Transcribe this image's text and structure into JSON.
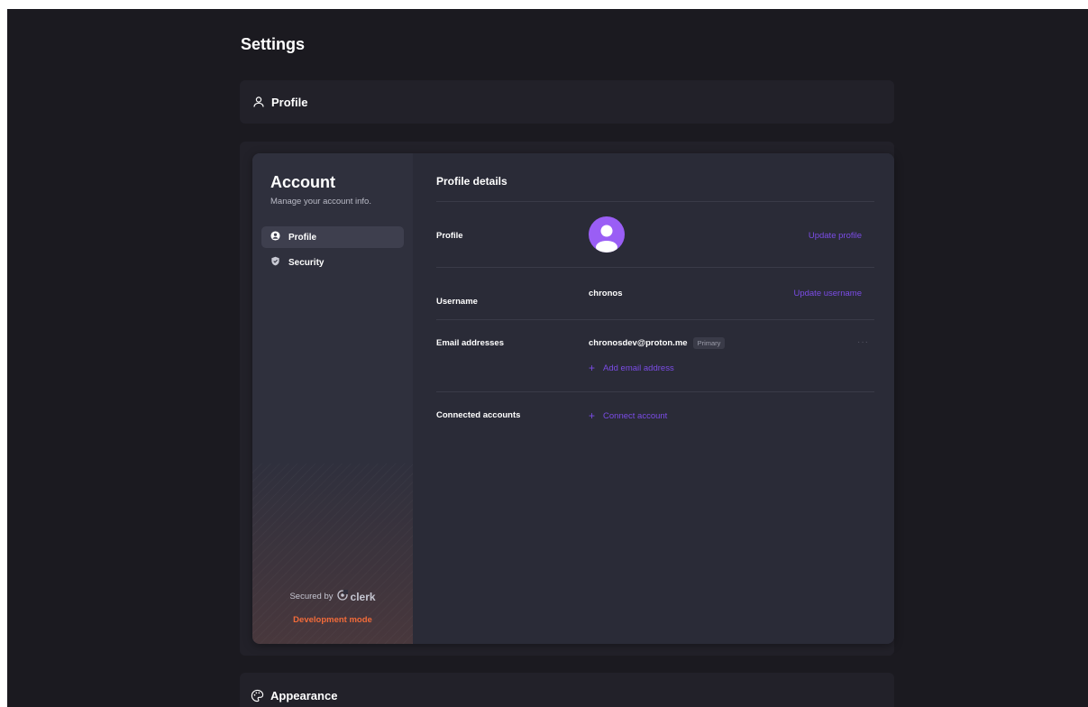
{
  "page": {
    "title": "Settings"
  },
  "sections": {
    "profile": {
      "label": "Profile"
    },
    "appearance": {
      "label": "Appearance"
    }
  },
  "account": {
    "title": "Account",
    "subtitle": "Manage your account info.",
    "nav": [
      {
        "label": "Profile",
        "icon": "user-circle-icon",
        "active": true
      },
      {
        "label": "Security",
        "icon": "shield-icon",
        "active": false
      }
    ],
    "footer": {
      "secured_by": "Secured by",
      "brand": "clerk",
      "mode": "Development mode"
    }
  },
  "profile_details": {
    "title": "Profile details",
    "rows": {
      "profile": {
        "label": "Profile",
        "action": "Update profile"
      },
      "username": {
        "label": "Username",
        "value": "chronos",
        "action": "Update username"
      },
      "email": {
        "label": "Email addresses",
        "value": "chronosdev@proton.me",
        "badge": "Primary",
        "add": "Add email address"
      },
      "connected": {
        "label": "Connected accounts",
        "action": "Connect account"
      }
    }
  },
  "colors": {
    "background": "#1b1a20",
    "accent": "#7b4ce6",
    "avatar": "#9a5ef5",
    "dev_mode": "#f26b3a"
  }
}
